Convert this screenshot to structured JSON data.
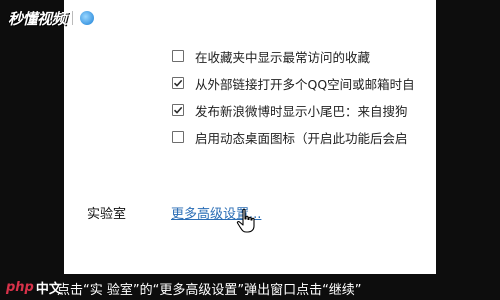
{
  "brand": {
    "name": "秒懂视频"
  },
  "options": [
    {
      "label": "在收藏夹中显示最常访问的收藏",
      "checked": false
    },
    {
      "label": "从外部链接打开多个QQ空间或邮箱时自",
      "checked": true
    },
    {
      "label": "发布新浪微博时显示小尾巴：来自搜狗",
      "checked": true
    },
    {
      "label": "启用动态桌面图标（开启此功能后会启",
      "checked": false
    }
  ],
  "lab_section": {
    "label": "实验室",
    "link": "更多高级设置..."
  },
  "watermark": {
    "php": "php",
    "cn": "中文"
  },
  "subtitle": "点击“实 验室”的“更多高级设置”弹出窗口点击“继续”"
}
